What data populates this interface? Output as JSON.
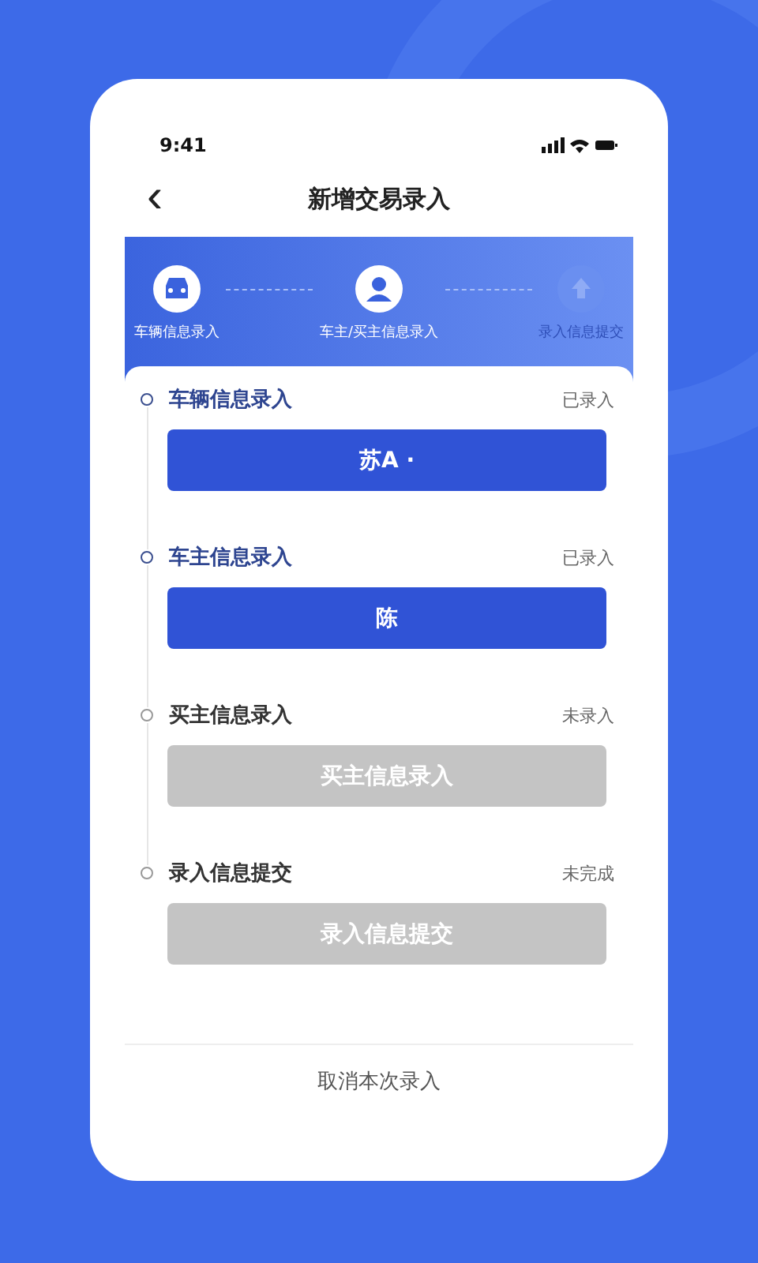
{
  "status_bar": {
    "time": "9:41"
  },
  "nav": {
    "back": "‹",
    "title": "新增交易录入"
  },
  "steps": [
    {
      "label": "车辆信息录入",
      "done": true
    },
    {
      "label": "车主/买主信息录入",
      "done": true
    },
    {
      "label": "录入信息提交",
      "done": false
    }
  ],
  "sections": [
    {
      "title": "车辆信息录入",
      "status": "已录入",
      "button": "苏A ·",
      "done": true
    },
    {
      "title": "车主信息录入",
      "status": "已录入",
      "button": "陈",
      "done": true
    },
    {
      "title": "买主信息录入",
      "status": "未录入",
      "button": "买主信息录入",
      "done": false
    },
    {
      "title": "录入信息提交",
      "status": "未完成",
      "button": "录入信息提交",
      "done": false
    }
  ],
  "cancel": "取消本次录入"
}
